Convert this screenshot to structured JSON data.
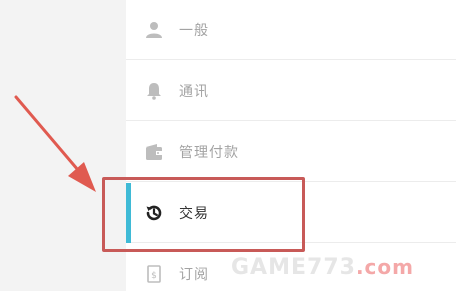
{
  "settings_menu": {
    "items": [
      {
        "label": "一般",
        "icon": "user-icon"
      },
      {
        "label": "通讯",
        "icon": "bell-icon"
      },
      {
        "label": "管理付款",
        "icon": "wallet-icon"
      },
      {
        "label": "交易",
        "icon": "history-icon"
      },
      {
        "label": "订阅",
        "icon": "subscription-icon"
      }
    ],
    "active_index": 3
  },
  "colors": {
    "active_bar": "#3fbad6",
    "highlight_box": "#c85a58",
    "arrow": "#e05a50"
  },
  "watermark": {
    "text": "GAME773",
    "suffix": ".com"
  }
}
